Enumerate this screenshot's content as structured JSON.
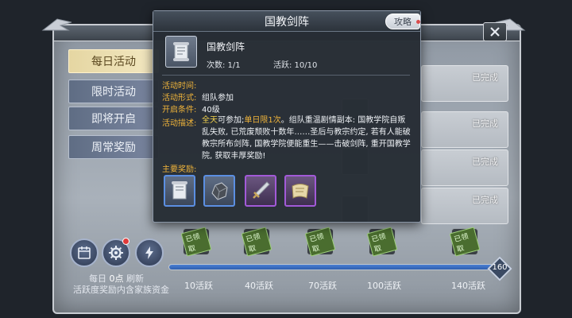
{
  "background_panel": {
    "tabs": [
      {
        "label": "每日活动",
        "active": true
      },
      {
        "label": "限时活动",
        "active": false
      },
      {
        "label": "即将开启",
        "active": false
      },
      {
        "label": "周常奖励",
        "active": false
      }
    ],
    "rows": [
      {
        "status": "已完成"
      },
      {
        "status": "已完成"
      },
      {
        "status": "已完成"
      },
      {
        "status": "已完成"
      }
    ],
    "daily_refresh": {
      "prefix": "每日",
      "time": "0点",
      "suffix": "刷新"
    },
    "hint": "活跃度奖励内含家族资金",
    "progress": {
      "cap": "160",
      "fraction": 1.0
    },
    "milestones": [
      {
        "label": "10活跃",
        "stamp": "已领取"
      },
      {
        "label": "40活跃",
        "stamp": "已领取"
      },
      {
        "label": "70活跃",
        "stamp": "已领取"
      },
      {
        "label": "100活跃",
        "stamp": "已领取"
      },
      {
        "label": "140活跃",
        "stamp": "已领取"
      }
    ]
  },
  "popup": {
    "title": "国教剑阵",
    "guide_button": "攻略",
    "activity_name": "国教剑阵",
    "count": "次数: 1/1",
    "active": "活跃: 10/10",
    "fields": {
      "time_label": "活动时间:",
      "time_value": "",
      "form_label": "活动形式:",
      "form_value": "组队参加",
      "cond_label": "开启条件:",
      "cond_value": "40级",
      "desc_label": "活动描述:"
    },
    "description": {
      "part1": "全天",
      "part2": "可参加;",
      "part3": "单日限1次",
      "part4": "。组队重温剧情副本: 国教学院自叛乱失败, 已荒废颓败十数年……圣后与教宗约定, 若有人能破教宗所布剑阵, 国教学院便能重生——击破剑阵, 重开国教学院, 获取丰厚奖励!"
    },
    "rewards_label": "主要奖励:",
    "rewards": [
      {
        "icon": "scroll-icon",
        "quality": "blue"
      },
      {
        "icon": "ore-icon",
        "quality": "blue"
      },
      {
        "icon": "sword-icon",
        "quality": "purple"
      },
      {
        "icon": "parchment-icon",
        "quality": "purple"
      }
    ]
  },
  "colors": {
    "accent_gold": "#f0b43a",
    "highlight_yellow": "#f2d24e",
    "quality_blue": "#5b8fe2",
    "quality_purple": "#a25ad8",
    "progress_blue": "#2f5fb0"
  }
}
